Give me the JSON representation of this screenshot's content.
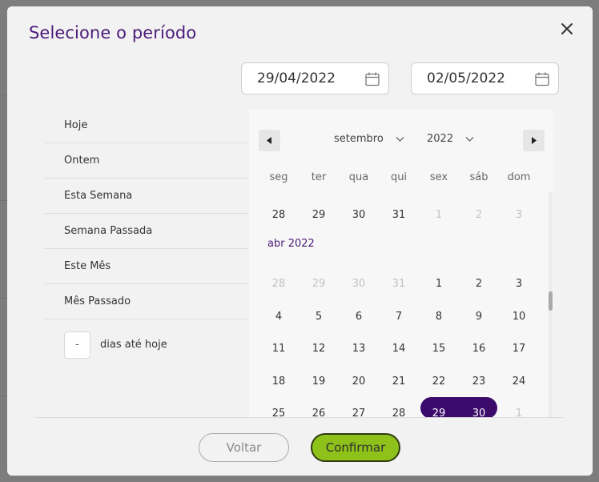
{
  "dialog": {
    "title": "Selecione o período",
    "close_icon": "close-icon"
  },
  "date_range": {
    "start": "29/04/2022",
    "end": "02/05/2022",
    "icon": "calendar-icon"
  },
  "presets": [
    {
      "label": "Hoje"
    },
    {
      "label": "Ontem"
    },
    {
      "label": "Esta Semana"
    },
    {
      "label": "Semana Passada"
    },
    {
      "label": "Este Mês"
    },
    {
      "label": "Mês Passado"
    }
  ],
  "days_until_today": {
    "value": "-",
    "label": "dias até hoje"
  },
  "calendar": {
    "month_select": "setembro",
    "year_select": "2022",
    "weekdays": [
      "seg",
      "ter",
      "qua",
      "qui",
      "sex",
      "sáb",
      "dom"
    ],
    "prev_rows": [
      [
        {
          "d": "28"
        },
        {
          "d": "29"
        },
        {
          "d": "30"
        },
        {
          "d": "31"
        },
        {
          "d": "1",
          "m": true
        },
        {
          "d": "2",
          "m": true
        },
        {
          "d": "3",
          "m": true
        }
      ]
    ],
    "month_label": "abr 2022",
    "rows": [
      [
        {
          "d": "28",
          "m": true
        },
        {
          "d": "29",
          "m": true
        },
        {
          "d": "30",
          "m": true
        },
        {
          "d": "31",
          "m": true
        },
        {
          "d": "1"
        },
        {
          "d": "2"
        },
        {
          "d": "3"
        }
      ],
      [
        {
          "d": "4"
        },
        {
          "d": "5"
        },
        {
          "d": "6"
        },
        {
          "d": "7"
        },
        {
          "d": "8"
        },
        {
          "d": "9"
        },
        {
          "d": "10"
        }
      ],
      [
        {
          "d": "11"
        },
        {
          "d": "12"
        },
        {
          "d": "13"
        },
        {
          "d": "14"
        },
        {
          "d": "15"
        },
        {
          "d": "16"
        },
        {
          "d": "17"
        }
      ],
      [
        {
          "d": "18"
        },
        {
          "d": "19"
        },
        {
          "d": "20"
        },
        {
          "d": "21"
        },
        {
          "d": "22"
        },
        {
          "d": "23"
        },
        {
          "d": "24"
        }
      ],
      [
        {
          "d": "25"
        },
        {
          "d": "26"
        },
        {
          "d": "27"
        },
        {
          "d": "28"
        },
        {
          "d": "29",
          "s": true
        },
        {
          "d": "30",
          "s": true
        },
        {
          "d": "1",
          "m": true
        }
      ]
    ],
    "selected_color": "#3b0a6b"
  },
  "buttons": {
    "back": "Voltar",
    "confirm": "Confirmar",
    "confirm_color": "#8ec21b"
  },
  "colors": {
    "accent": "#4b1a7a"
  }
}
